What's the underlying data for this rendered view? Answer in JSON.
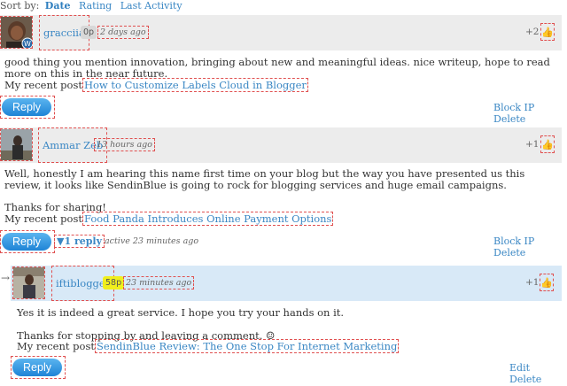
{
  "sort": {
    "label": "Sort by:",
    "active": "Date",
    "options": [
      "Rating",
      "Last Activity"
    ]
  },
  "comments": [
    {
      "author": "gracciia",
      "points": "0p",
      "time": "2 days ago",
      "score": "+2",
      "like_icon": "thumb-up-icon",
      "text": "good thing you mention innovation, bringing about new and meaningful ideas. nice writeup, hope to read more on this in the near future.",
      "recent_prefix": "My recent post",
      "recent_link": "How to Customize Labels Cloud in Blogger",
      "reply_label": "Reply",
      "actions": [
        "Block IP",
        "Delete"
      ]
    },
    {
      "author": "Ammar Zeb",
      "time": "13 hours ago",
      "score": "+1",
      "like_icon": "thumb-up-icon",
      "text": "Well, honestly I am hearing this name first time on your blog but the way you have presented us this review, it looks like SendinBlue is going to rock for blogging services and huge email campaigns.",
      "text2": "Thanks for sharing!",
      "recent_prefix": "My recent post",
      "recent_link": "Food Panda Introduces Online Payment Options",
      "reply_label": "Reply",
      "toggle": "▼1 reply",
      "active_note": "active 23 minutes ago",
      "actions": [
        "Block IP",
        "Delete"
      ]
    },
    {
      "author": "iftiblogger",
      "points": "58p",
      "time": "23 minutes ago",
      "score": "+1",
      "like_icon": "thumb-up-icon",
      "text": "Yes it is indeed a great service. I hope you try your hands on it.",
      "text2": "Thanks for stopping by and leaving a comment. ☺",
      "recent_prefix": "My recent post",
      "recent_link": "SendinBlue Review: The One Stop For Internet Marketing",
      "reply_label": "Reply",
      "actions": [
        "Edit",
        "Delete"
      ]
    }
  ],
  "reply_arrow": "→"
}
